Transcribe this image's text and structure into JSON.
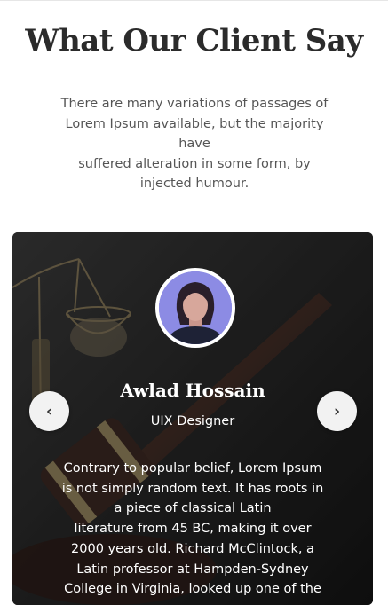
{
  "section": {
    "title": "What Our Client Say",
    "subtitle_lines": [
      "There are many variations of passages of",
      "Lorem Ipsum available, but the majority",
      "have",
      "suffered alteration in some form, by",
      "injected humour."
    ]
  },
  "testimonial": {
    "name": "Awlad Hossain",
    "role": "UIX Designer",
    "quote_lines": [
      "Contrary to popular belief, Lorem Ipsum",
      "is not simply random text. It has roots in",
      "a piece of classical Latin",
      "literature from 45 BC, making it over",
      "2000 years old. Richard McClintock, a",
      "Latin professor at Hampden-Sydney",
      "College in Virginia, looked up one of the"
    ]
  },
  "navigation": {
    "prev_icon": "chevron-left-icon",
    "prev_glyph": "‹",
    "next_icon": "chevron-right-icon",
    "next_glyph": "›"
  },
  "colors": {
    "heading": "#2b2b2b",
    "body_text": "#555555",
    "card_background": "#1c1c1c",
    "nav_button": "#f2f2f2"
  }
}
